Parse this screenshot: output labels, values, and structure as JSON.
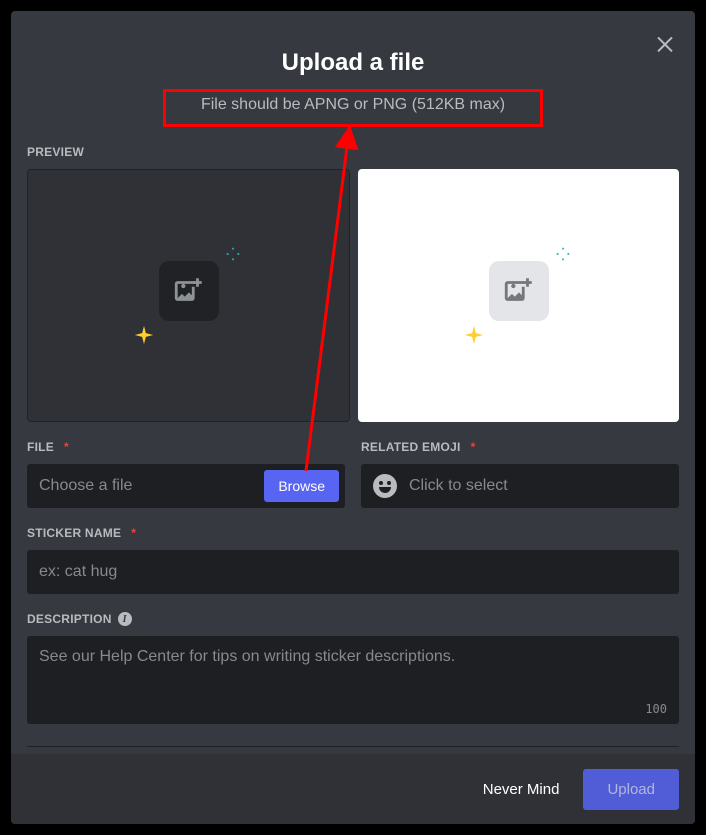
{
  "modal": {
    "title": "Upload a file",
    "subtitle": "File should be APNG or PNG (512KB max)"
  },
  "labels": {
    "preview": "PREVIEW",
    "file": "FILE",
    "related_emoji": "RELATED EMOJI",
    "sticker_name": "STICKER NAME",
    "description": "DESCRIPTION"
  },
  "file": {
    "placeholder": "Choose a file",
    "browse": "Browse"
  },
  "emoji": {
    "placeholder": "Click to select"
  },
  "sticker_name": {
    "placeholder": "ex: cat hug"
  },
  "description": {
    "placeholder": "See our Help Center for tips on writing sticker descriptions.",
    "max": "100"
  },
  "footer": {
    "cancel": "Never Mind",
    "submit": "Upload"
  },
  "colors": {
    "accent": "#5865f2",
    "bg": "#36393f",
    "input_bg": "#1e1f22",
    "danger": "#ed4245"
  }
}
